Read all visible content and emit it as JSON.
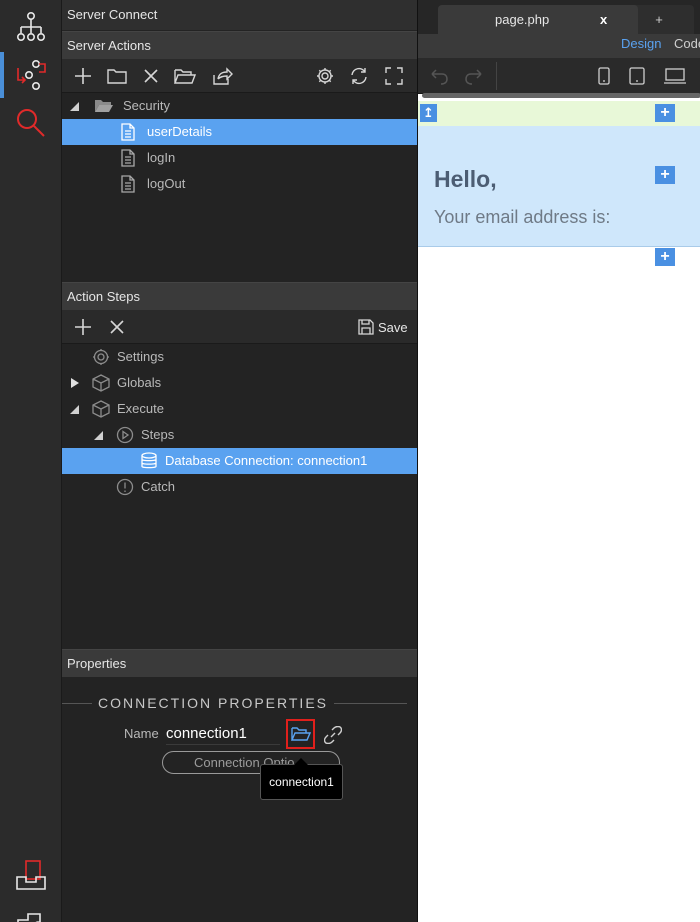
{
  "rail": {
    "items": [
      "app-structure-icon",
      "server-connect-icon",
      "search-icon",
      "publish-icon",
      "database-icon"
    ]
  },
  "panel": {
    "title": "Server Connect",
    "server_actions": {
      "header": "Server Actions",
      "tree": {
        "folder": "Security",
        "items": [
          "userDetails",
          "logIn",
          "logOut"
        ],
        "selected": "userDetails"
      }
    },
    "action_steps": {
      "header": "Action Steps",
      "save_label": "Save",
      "tree": {
        "settings": "Settings",
        "globals": "Globals",
        "execute": "Execute",
        "steps": "Steps",
        "db_connection": "Database Connection: connection1",
        "catch": "Catch"
      }
    },
    "properties": {
      "header": "Properties",
      "section_title": "CONNECTION PROPERTIES",
      "name_label": "Name",
      "name_value": "connection1",
      "options_button": "Connection Optio",
      "tooltip": "connection1"
    }
  },
  "canvas": {
    "tab_title": "page.php",
    "tab_close": "x",
    "new_tab": "+",
    "mode_design": "Design",
    "mode_code": "Code",
    "heading": "Hello,",
    "subtext": "Your email address is:"
  },
  "colors": {
    "selection": "#5aa2f0",
    "accent": "#4a90e2",
    "highlight_box": "#e0201c",
    "hero_bg": "#cfe7fb",
    "strip_bg": "#e8f8d8"
  }
}
